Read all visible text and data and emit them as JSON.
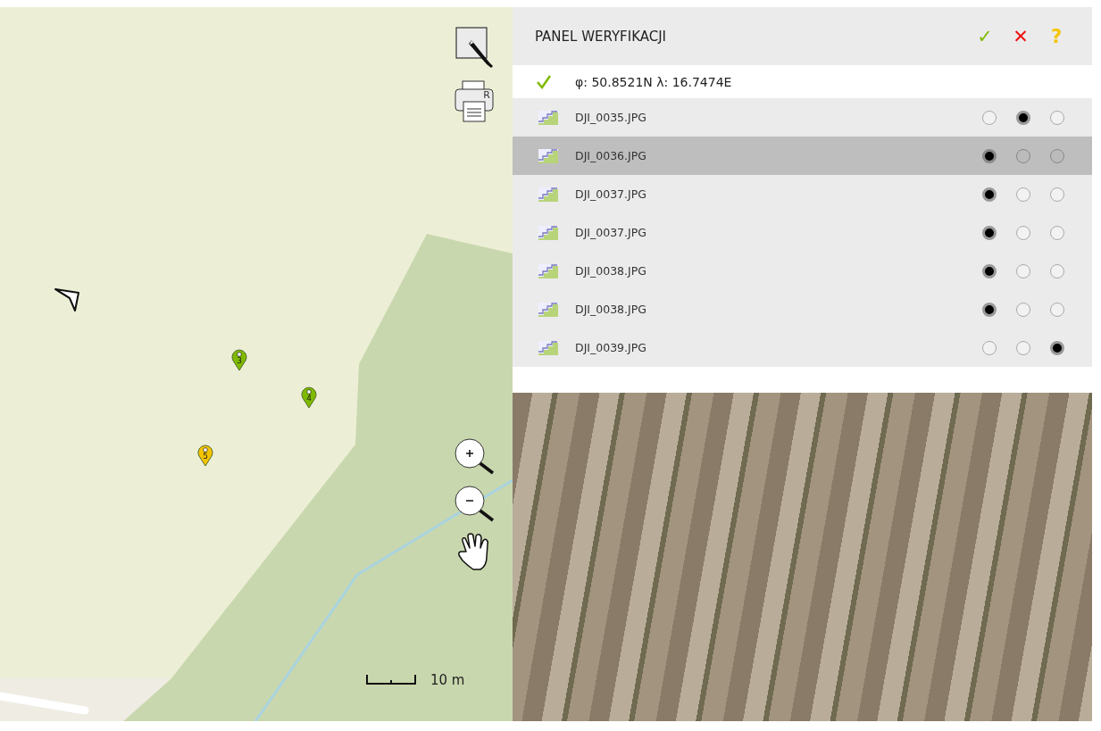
{
  "map": {
    "pins": [
      {
        "label": "3",
        "color": "#7fba00"
      },
      {
        "label": "4",
        "color": "#7fba00"
      },
      {
        "label": "5",
        "color": "#f5c400"
      }
    ],
    "printer_letter": "R",
    "scale": "10 m"
  },
  "panel": {
    "title": "PANEL WERYFIKACJI",
    "columns": [
      {
        "glyph": "✓",
        "color": "#7fba00"
      },
      {
        "glyph": "✕",
        "color": "#ee1111"
      },
      {
        "glyph": "?",
        "color": "#f5c400"
      }
    ],
    "rows": [
      {
        "kind": "geo",
        "text": "φ: 50.8521N λ: 16.7474E"
      },
      {
        "kind": "photo",
        "text": "DJI_0035.JPG",
        "selected": false,
        "checks": [
          false,
          true,
          false
        ]
      },
      {
        "kind": "photo",
        "text": "DJI_0036.JPG",
        "selected": true,
        "checks": [
          true,
          false,
          false
        ]
      },
      {
        "kind": "photo",
        "text": "DJI_0037.JPG",
        "selected": false,
        "checks": [
          true,
          false,
          false
        ]
      },
      {
        "kind": "photo",
        "text": "DJI_0037.JPG",
        "selected": false,
        "checks": [
          true,
          false,
          false
        ]
      },
      {
        "kind": "photo",
        "text": "DJI_0038.JPG",
        "selected": false,
        "checks": [
          true,
          false,
          false
        ]
      },
      {
        "kind": "photo",
        "text": "DJI_0038.JPG",
        "selected": false,
        "checks": [
          true,
          false,
          false
        ]
      },
      {
        "kind": "photo",
        "text": "DJI_0039.JPG",
        "selected": false,
        "checks": [
          false,
          false,
          true
        ]
      }
    ]
  }
}
